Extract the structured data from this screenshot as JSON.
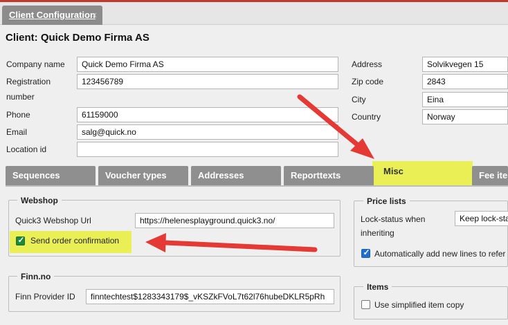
{
  "window": {
    "tab_label": "Client Configuration",
    "close_glyph": "x"
  },
  "client": {
    "title": "Client: Quick Demo Firma AS"
  },
  "form": {
    "company_name_label": "Company name",
    "company_name_value": "Quick Demo Firma AS",
    "registration_label_line1": "Registration",
    "registration_label_line2": "number",
    "registration_value": "123456789",
    "phone_label": "Phone",
    "phone_value": "61159000",
    "email_label": "Email",
    "email_value": "salg@quick.no",
    "location_label": "Location id",
    "location_value": "",
    "address_label": "Address",
    "address_value": "Solvikvegen 15",
    "zip_label": "Zip code",
    "zip_value": "2843",
    "city_label": "City",
    "city_value": "Eina",
    "country_label": "Country",
    "country_value": "Norway"
  },
  "tabs": [
    {
      "label": "Sequences"
    },
    {
      "label": "Voucher types"
    },
    {
      "label": "Addresses"
    },
    {
      "label": "Reporttexts"
    },
    {
      "label": "Misc"
    },
    {
      "label": "Fee ite"
    }
  ],
  "webshop": {
    "title": "Webshop",
    "url_label": "Quick3 Webshop Url",
    "url_value": "https://helenesplayground.quick3.no/",
    "send_confirmation_label": "Send order confirmation",
    "send_confirmation_checked": true
  },
  "finn": {
    "title": "Finn.no",
    "provider_label": "Finn Provider ID",
    "provider_value": "finntechtest$1283343179$_vKSZkFVoL7t62l76hubeDKLR5pRh"
  },
  "price_lists": {
    "title": "Price lists",
    "lock_label_line1": "Lock-status when",
    "lock_label_line2": "inheriting",
    "lock_value": "Keep lock-sta",
    "auto_add_label": "Automatically add new lines to refer",
    "auto_add_checked": true
  },
  "items": {
    "title": "Items",
    "simplified_label": "Use simplified item copy",
    "simplified_checked": false
  },
  "annotation": {
    "highlight_color": "#e8ee3a",
    "arrow_color": "#e53935"
  }
}
